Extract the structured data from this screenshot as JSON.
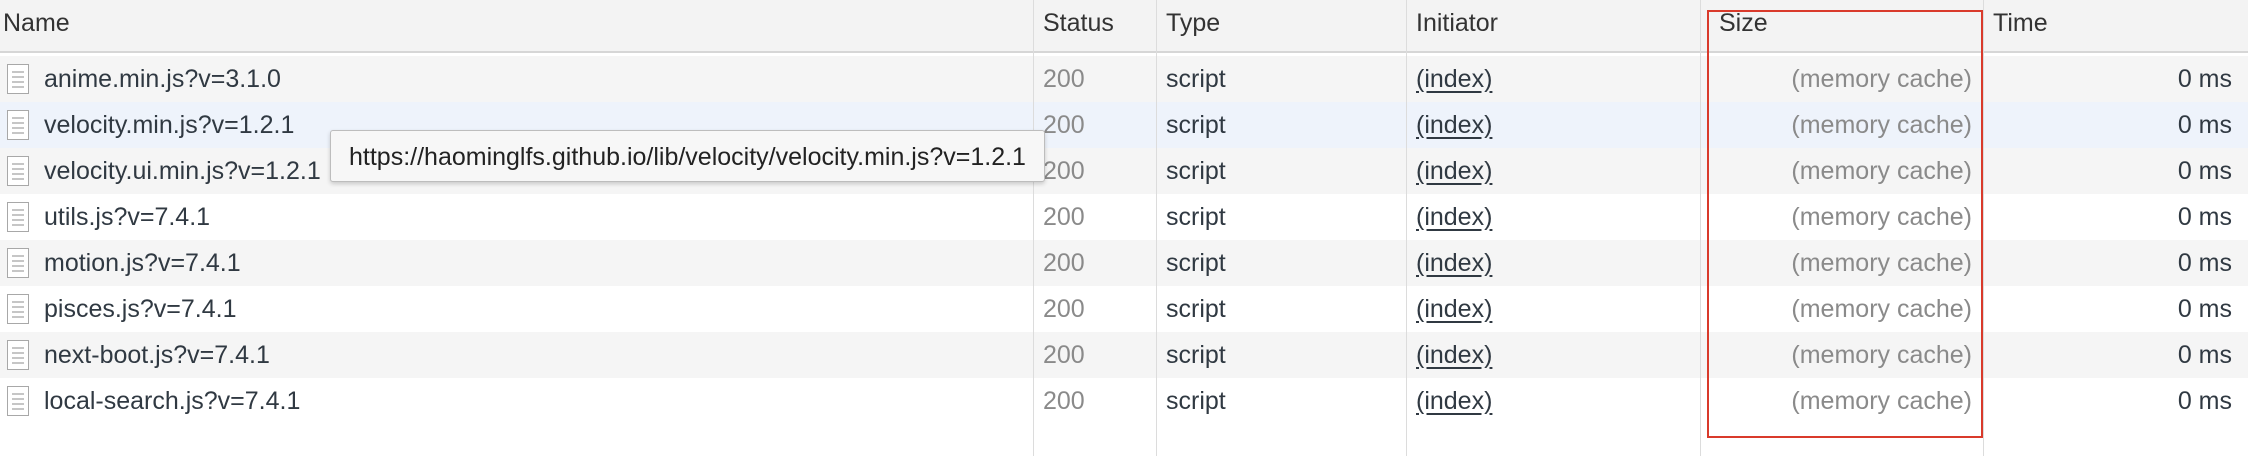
{
  "columns": {
    "name": "Name",
    "status": "Status",
    "type": "Type",
    "initiator": "Initiator",
    "size": "Size",
    "time": "Time"
  },
  "rows": [
    {
      "name": "anime.min.js?v=3.1.0",
      "status": "200",
      "type": "script",
      "initiator": "(index)",
      "size": "(memory cache)",
      "time": "0 ms"
    },
    {
      "name": "velocity.min.js?v=1.2.1",
      "status": "200",
      "type": "script",
      "initiator": "(index)",
      "size": "(memory cache)",
      "time": "0 ms"
    },
    {
      "name": "velocity.ui.min.js?v=1.2.1",
      "status": "200",
      "type": "script",
      "initiator": "(index)",
      "size": "(memory cache)",
      "time": "0 ms"
    },
    {
      "name": "utils.js?v=7.4.1",
      "status": "200",
      "type": "script",
      "initiator": "(index)",
      "size": "(memory cache)",
      "time": "0 ms"
    },
    {
      "name": "motion.js?v=7.4.1",
      "status": "200",
      "type": "script",
      "initiator": "(index)",
      "size": "(memory cache)",
      "time": "0 ms"
    },
    {
      "name": "pisces.js?v=7.4.1",
      "status": "200",
      "type": "script",
      "initiator": "(index)",
      "size": "(memory cache)",
      "time": "0 ms"
    },
    {
      "name": "next-boot.js?v=7.4.1",
      "status": "200",
      "type": "script",
      "initiator": "(index)",
      "size": "(memory cache)",
      "time": "0 ms"
    },
    {
      "name": "local-search.js?v=7.4.1",
      "status": "200",
      "type": "script",
      "initiator": "(index)",
      "size": "(memory cache)",
      "time": "0 ms"
    }
  ],
  "tooltip": {
    "text": "https://haominglfs.github.io/lib/velocity/velocity.min.js?v=1.2.1"
  },
  "colors": {
    "highlight_border": "#d93a2b",
    "hover_row": "#eef3fb",
    "striped_row": "#f5f5f5"
  },
  "icons": {
    "row_icon": "document-file-icon"
  }
}
